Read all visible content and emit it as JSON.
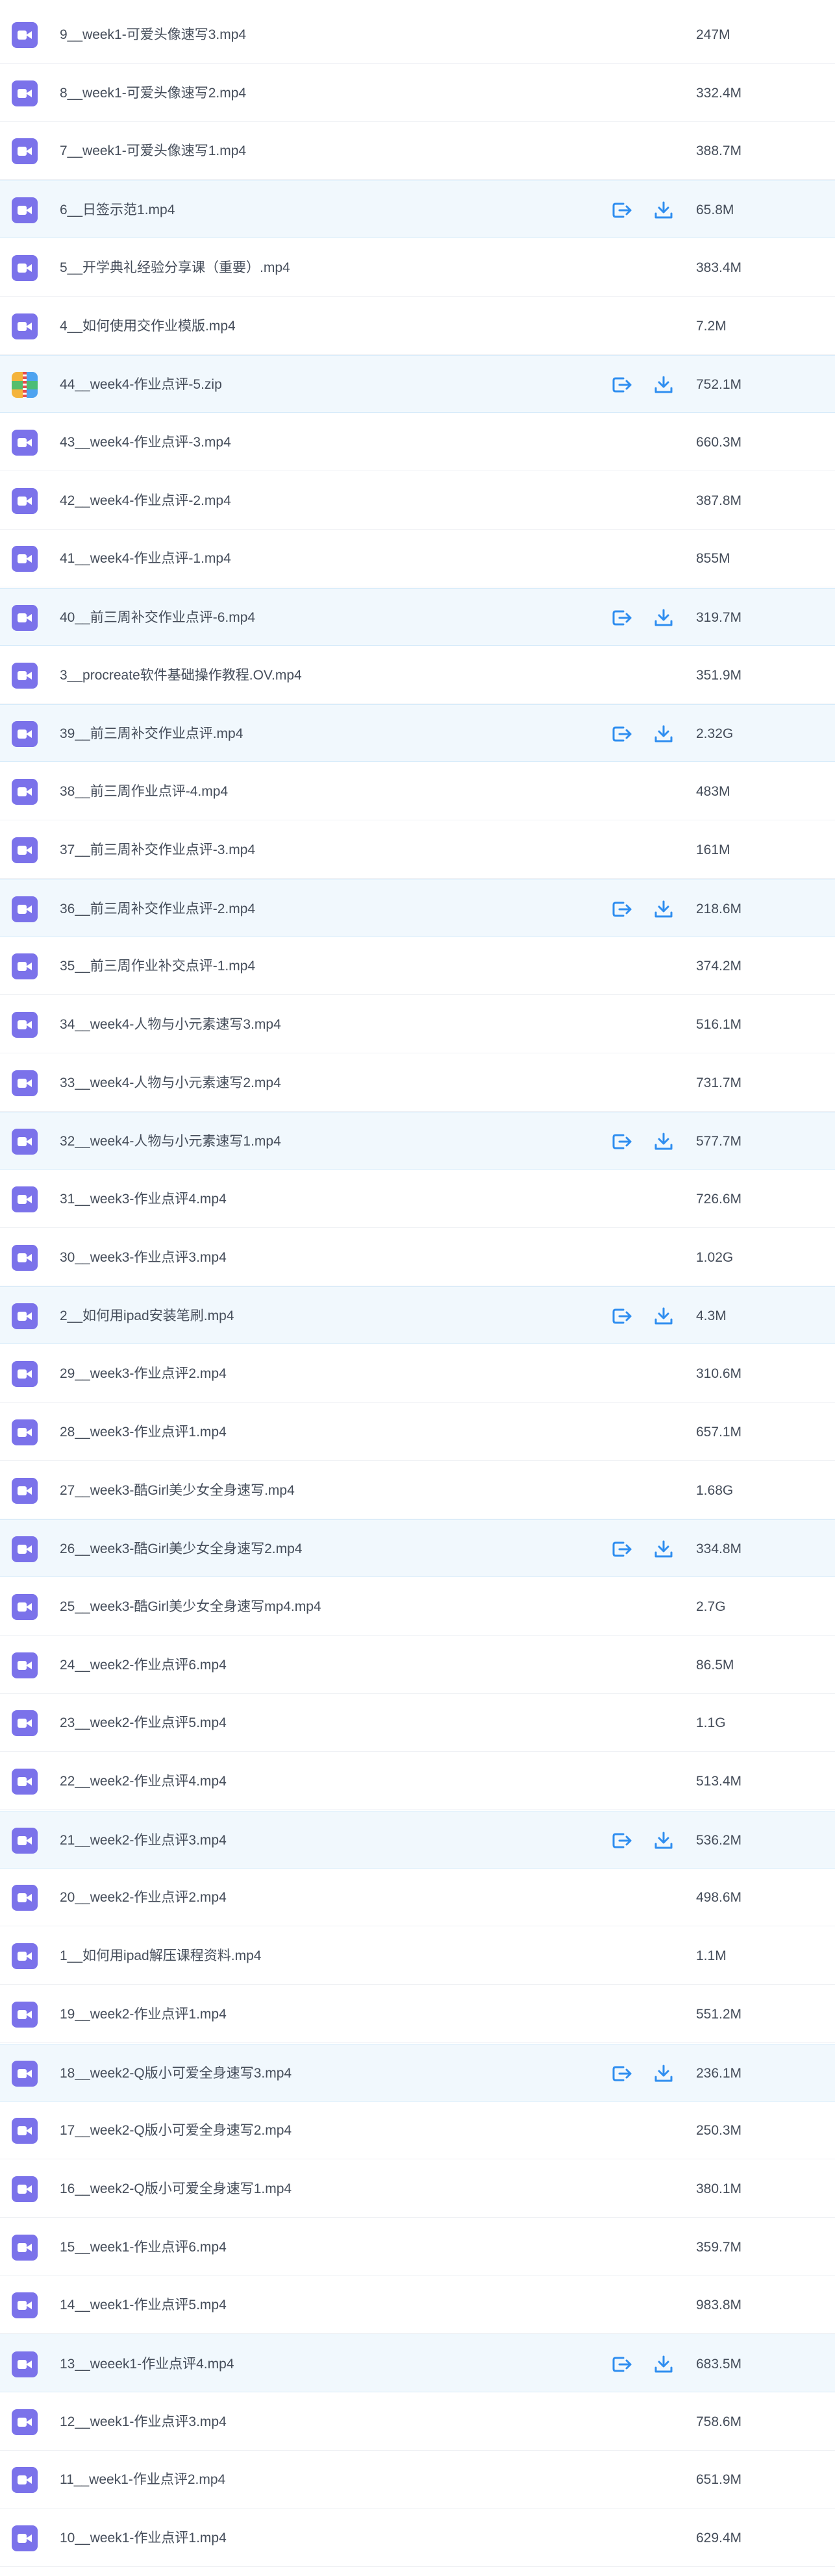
{
  "colors": {
    "video_icon": "#7b72ea",
    "highlight_bg": "#f1f8fd",
    "action_icon": "#2f8ef0",
    "text": "#454d5a"
  },
  "icons": {
    "video": "video-file-icon",
    "zip": "zip-archive-icon",
    "share": "share-icon",
    "download": "download-icon"
  },
  "files": [
    {
      "name": "9__week1-可爱头像速写3.mp4",
      "size": "247M",
      "type": "video",
      "highlighted": false
    },
    {
      "name": "8__week1-可爱头像速写2.mp4",
      "size": "332.4M",
      "type": "video",
      "highlighted": false
    },
    {
      "name": "7__week1-可爱头像速写1.mp4",
      "size": "388.7M",
      "type": "video",
      "highlighted": false
    },
    {
      "name": "6__日签示范1.mp4",
      "size": "65.8M",
      "type": "video",
      "highlighted": true
    },
    {
      "name": "5__开学典礼经验分享课（重要）.mp4",
      "size": "383.4M",
      "type": "video",
      "highlighted": false
    },
    {
      "name": "4__如何使用交作业模版.mp4",
      "size": "7.2M",
      "type": "video",
      "highlighted": false
    },
    {
      "name": "44__week4-作业点评-5.zip",
      "size": "752.1M",
      "type": "zip",
      "highlighted": true
    },
    {
      "name": "43__week4-作业点评-3.mp4",
      "size": "660.3M",
      "type": "video",
      "highlighted": false
    },
    {
      "name": "42__week4-作业点评-2.mp4",
      "size": "387.8M",
      "type": "video",
      "highlighted": false
    },
    {
      "name": "41__week4-作业点评-1.mp4",
      "size": "855M",
      "type": "video",
      "highlighted": false
    },
    {
      "name": "40__前三周补交作业点评-6.mp4",
      "size": "319.7M",
      "type": "video",
      "highlighted": true
    },
    {
      "name": "3__procreate软件基础操作教程.OV.mp4",
      "size": "351.9M",
      "type": "video",
      "highlighted": false
    },
    {
      "name": "39__前三周补交作业点评.mp4",
      "size": "2.32G",
      "type": "video",
      "highlighted": true
    },
    {
      "name": "38__前三周作业点评-4.mp4",
      "size": "483M",
      "type": "video",
      "highlighted": false
    },
    {
      "name": "37__前三周补交作业点评-3.mp4",
      "size": "161M",
      "type": "video",
      "highlighted": false
    },
    {
      "name": "36__前三周补交作业点评-2.mp4",
      "size": "218.6M",
      "type": "video",
      "highlighted": true
    },
    {
      "name": "35__前三周作业补交点评-1.mp4",
      "size": "374.2M",
      "type": "video",
      "highlighted": false
    },
    {
      "name": "34__week4-人物与小元素速写3.mp4",
      "size": "516.1M",
      "type": "video",
      "highlighted": false
    },
    {
      "name": "33__week4-人物与小元素速写2.mp4",
      "size": "731.7M",
      "type": "video",
      "highlighted": false
    },
    {
      "name": "32__week4-人物与小元素速写1.mp4",
      "size": "577.7M",
      "type": "video",
      "highlighted": true
    },
    {
      "name": "31__week3-作业点评4.mp4",
      "size": "726.6M",
      "type": "video",
      "highlighted": false
    },
    {
      "name": "30__week3-作业点评3.mp4",
      "size": "1.02G",
      "type": "video",
      "highlighted": false
    },
    {
      "name": "2__如何用ipad安装笔刷.mp4",
      "size": "4.3M",
      "type": "video",
      "highlighted": true
    },
    {
      "name": "29__week3-作业点评2.mp4",
      "size": "310.6M",
      "type": "video",
      "highlighted": false
    },
    {
      "name": "28__week3-作业点评1.mp4",
      "size": "657.1M",
      "type": "video",
      "highlighted": false
    },
    {
      "name": "27__week3-酷Girl美少女全身速写.mp4",
      "size": "1.68G",
      "type": "video",
      "highlighted": false
    },
    {
      "name": "26__week3-酷Girl美少女全身速写2.mp4",
      "size": "334.8M",
      "type": "video",
      "highlighted": true
    },
    {
      "name": "25__week3-酷Girl美少女全身速写mp4.mp4",
      "size": "2.7G",
      "type": "video",
      "highlighted": false
    },
    {
      "name": "24__week2-作业点评6.mp4",
      "size": "86.5M",
      "type": "video",
      "highlighted": false
    },
    {
      "name": "23__week2-作业点评5.mp4",
      "size": "1.1G",
      "type": "video",
      "highlighted": false
    },
    {
      "name": "22__week2-作业点评4.mp4",
      "size": "513.4M",
      "type": "video",
      "highlighted": false
    },
    {
      "name": "21__week2-作业点评3.mp4",
      "size": "536.2M",
      "type": "video",
      "highlighted": true
    },
    {
      "name": "20__week2-作业点评2.mp4",
      "size": "498.6M",
      "type": "video",
      "highlighted": false
    },
    {
      "name": "1__如何用ipad解压课程资料.mp4",
      "size": "1.1M",
      "type": "video",
      "highlighted": false
    },
    {
      "name": "19__week2-作业点评1.mp4",
      "size": "551.2M",
      "type": "video",
      "highlighted": false
    },
    {
      "name": "18__week2-Q版小可爱全身速写3.mp4",
      "size": "236.1M",
      "type": "video",
      "highlighted": true
    },
    {
      "name": "17__week2-Q版小可爱全身速写2.mp4",
      "size": "250.3M",
      "type": "video",
      "highlighted": false
    },
    {
      "name": "16__week2-Q版小可爱全身速写1.mp4",
      "size": "380.1M",
      "type": "video",
      "highlighted": false
    },
    {
      "name": "15__week1-作业点评6.mp4",
      "size": "359.7M",
      "type": "video",
      "highlighted": false
    },
    {
      "name": "14__week1-作业点评5.mp4",
      "size": "983.8M",
      "type": "video",
      "highlighted": false
    },
    {
      "name": "13__weeek1-作业点评4.mp4",
      "size": "683.5M",
      "type": "video",
      "highlighted": true
    },
    {
      "name": "12__week1-作业点评3.mp4",
      "size": "758.6M",
      "type": "video",
      "highlighted": false
    },
    {
      "name": "11__week1-作业点评2.mp4",
      "size": "651.9M",
      "type": "video",
      "highlighted": false
    },
    {
      "name": "10__week1-作业点评1.mp4",
      "size": "629.4M",
      "type": "video",
      "highlighted": false
    }
  ]
}
